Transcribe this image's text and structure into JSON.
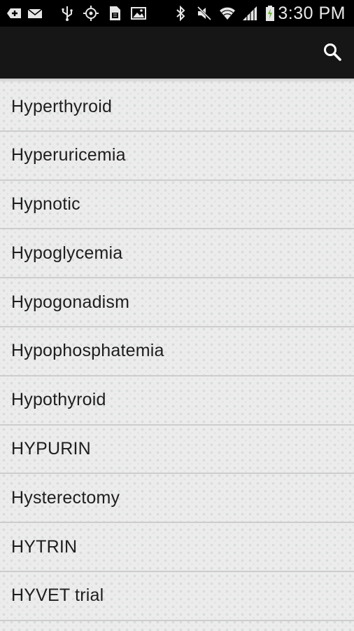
{
  "status_bar": {
    "time": "3:30 PM",
    "left_icons": [
      "add-notification-icon",
      "mail-icon",
      "usb-icon",
      "gps-icon",
      "sim-icon",
      "image-icon"
    ],
    "right_icons": [
      "bluetooth-icon",
      "mute-icon",
      "wifi-icon",
      "signal-icon",
      "battery-charging-icon"
    ]
  },
  "action_bar": {
    "search_icon": "search-icon"
  },
  "list": {
    "items": [
      {
        "label": "Hyperthyroid"
      },
      {
        "label": "Hyperuricemia"
      },
      {
        "label": "Hypnotic"
      },
      {
        "label": "Hypoglycemia"
      },
      {
        "label": "Hypogonadism"
      },
      {
        "label": "Hypophosphatemia"
      },
      {
        "label": "Hypothyroid"
      },
      {
        "label": "HYPURIN"
      },
      {
        "label": "Hysterectomy"
      },
      {
        "label": "HYTRIN"
      },
      {
        "label": "HYVET trial"
      }
    ]
  },
  "colors": {
    "status_bar_bg": "#000000",
    "action_bar_bg": "#161616",
    "list_bg": "#ececec",
    "divider": "#cdcdcd",
    "text": "#1e1e1e"
  }
}
